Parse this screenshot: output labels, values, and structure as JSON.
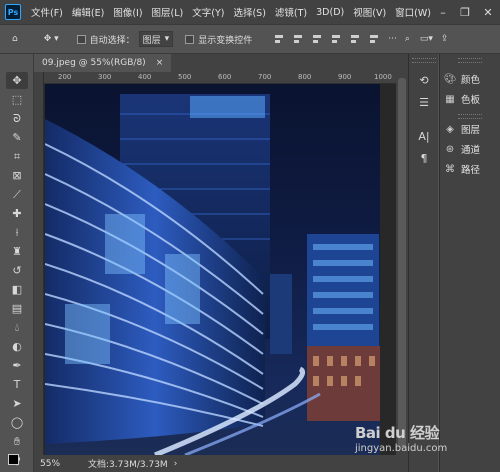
{
  "app": {
    "logo": "Ps",
    "menus": [
      "文件(F)",
      "编辑(E)",
      "图像(I)",
      "图层(L)",
      "文字(Y)",
      "选择(S)",
      "滤镜(T)",
      "3D(D)",
      "视图(V)",
      "窗口(W)"
    ],
    "window_controls": [
      "minimize-icon",
      "restore-icon",
      "close-icon"
    ]
  },
  "options": {
    "auto_select_label": "自动选择：",
    "auto_select_value": "图层",
    "show_transform_label": "显示变换控件",
    "extra_icons": [
      "search-icon",
      "workspace-icon",
      "share-icon"
    ]
  },
  "document": {
    "tab_title": "09.jpeg @ 55%(RGB/8)",
    "close_glyph": "×"
  },
  "ruler": {
    "top_marks": [
      "200",
      "300",
      "400",
      "500",
      "600",
      "700",
      "800",
      "900",
      "1000"
    ]
  },
  "status": {
    "zoom": "55%",
    "doc_size": "文档:3.73M/3.73M"
  },
  "panels": {
    "group1": [
      {
        "icon": "palette-icon",
        "label": "颜色"
      },
      {
        "icon": "swatches-icon",
        "label": "色板"
      }
    ],
    "group2": [
      {
        "icon": "layers-icon",
        "label": "图层"
      },
      {
        "icon": "channels-icon",
        "label": "通道"
      },
      {
        "icon": "paths-icon",
        "label": "路径"
      }
    ]
  },
  "tools": [
    "move-tool",
    "marquee-tool",
    "lasso-tool",
    "quick-select-tool",
    "crop-tool",
    "frame-tool",
    "eyedropper-tool",
    "healing-brush-tool",
    "brush-tool",
    "clone-stamp-tool",
    "history-brush-tool",
    "eraser-tool",
    "gradient-tool",
    "blur-tool",
    "dodge-tool",
    "pen-tool",
    "type-tool",
    "path-select-tool",
    "ellipse-tool",
    "hand-tool",
    "zoom-tool"
  ],
  "canvas": {
    "subject": "night city skyline with illuminated curved glass building and light trails",
    "colors": {
      "sky": "#0f1c44",
      "glow": "#4a8dff",
      "building": "#1d3a78",
      "trail": "#a9c6ff"
    }
  },
  "watermark": {
    "brand": "Bai du 经验",
    "url": "jingyan.baidu.com"
  }
}
